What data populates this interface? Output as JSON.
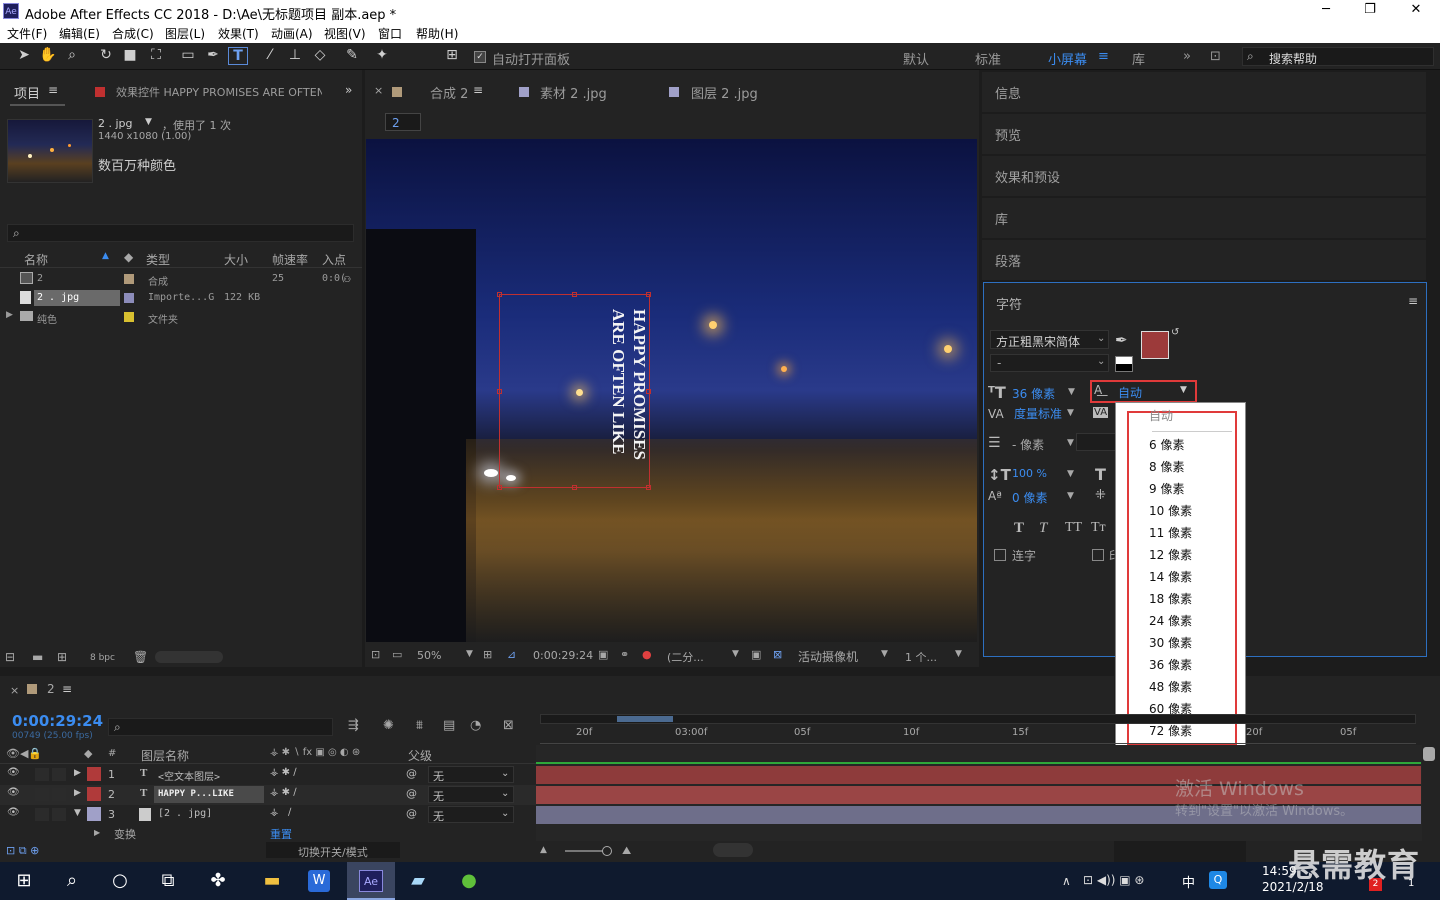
{
  "titlebar": {
    "title": "Adobe After Effects CC 2018 - D:\\Ae\\无标题项目 副本.aep *",
    "minimize": "─",
    "maximize": "❐",
    "close": "✕"
  },
  "menu": [
    "文件(F)",
    "编辑(E)",
    "合成(C)",
    "图层(L)",
    "效果(T)",
    "动画(A)",
    "视图(V)",
    "窗口",
    "帮助(H)"
  ],
  "toolbar": {
    "auto_open": "自动打开面板",
    "workspaces": [
      "默认",
      "标准",
      "小屏幕",
      "库"
    ],
    "active_workspace": "小屏幕",
    "search_placeholder": "搜索帮助"
  },
  "project": {
    "tab_project": "项目",
    "tab_effects": "效果控件 HAPPY PROMISES ARE OFTEN",
    "asset_name": "2 . jpg",
    "asset_used": "，使用了 1 次",
    "asset_dim": "1440 x1080 (1.00)",
    "asset_color": "数百万种颜色",
    "columns": [
      "名称",
      "类型",
      "大小",
      "帧速率",
      "入点"
    ],
    "rows": [
      {
        "name": "2",
        "type": "合成",
        "size": "",
        "fps": "25",
        "in": "0:0(",
        "color": "#b09a7a"
      },
      {
        "name": "2 . jpg",
        "type": "Importe...G",
        "size": "122 KB",
        "fps": "",
        "in": "",
        "color": "#8c8cba"
      },
      {
        "name": "纯色",
        "type": "文件夹",
        "size": "",
        "fps": "",
        "in": "",
        "color": "#d8c030"
      }
    ],
    "bpc": "8 bpc"
  },
  "viewer": {
    "tabs": [
      "合成 2",
      "素材 2 .jpg",
      "图层 2 .jpg"
    ],
    "breadcrumb": "2",
    "text_line1": "HAPPY PROMISES",
    "text_line2": "ARE OFTEN LIKE",
    "zoom": "50%",
    "timecode": "0:00:29:24",
    "resolution": "(二分...",
    "camera": "活动摄像机",
    "views": "1 个..."
  },
  "right_panels": [
    "信息",
    "预览",
    "效果和预设",
    "库",
    "段落"
  ],
  "character": {
    "title": "字符",
    "font": "方正粗黑宋简体",
    "style": "-",
    "fill_color": "#9c3a3a",
    "size": "36 像素",
    "leading": "自动",
    "kerning": "度量标准",
    "tracking": "- 像素",
    "vscale": "100 %",
    "baseline": "0 像素",
    "ligature": "连字",
    "hindi": "印"
  },
  "dropdown": {
    "options": [
      "自动",
      "6 像素",
      "8 像素",
      "9 像素",
      "10 像素",
      "11 像素",
      "12 像素",
      "14 像素",
      "18 像素",
      "24 像素",
      "30 像素",
      "36 像素",
      "48 像素",
      "60 像素",
      "72 像素"
    ]
  },
  "timeline": {
    "comp": "2",
    "timecode": "0:00:29:24",
    "frame_info": "00749 (25.00 fps)",
    "col_name": "图层名称",
    "col_parent": "父级",
    "layers": [
      {
        "num": "1",
        "name": "<空文本图层>",
        "parent": "无",
        "color": "#b03a3a"
      },
      {
        "num": "2",
        "name": "HAPPY P...LIKE",
        "parent": "无",
        "color": "#b03a3a"
      },
      {
        "num": "3",
        "name": "[2 . jpg]",
        "parent": "无",
        "color": "#a0a0c8"
      }
    ],
    "transform": "变换",
    "reset": "重置",
    "toggle": "切换开关/模式",
    "ruler": [
      "20f",
      "03:00f",
      "05f",
      "10f",
      "15f",
      "20f",
      "05f"
    ]
  },
  "watermark": {
    "line1": "激活 Windows",
    "line2": "转到\"设置\"以激活 Windows。",
    "brand": "悬需教育"
  },
  "taskbar": {
    "time": "14:59",
    "date": "2021/2/18",
    "ime": "中",
    "badge": "2",
    "notif": "1"
  }
}
